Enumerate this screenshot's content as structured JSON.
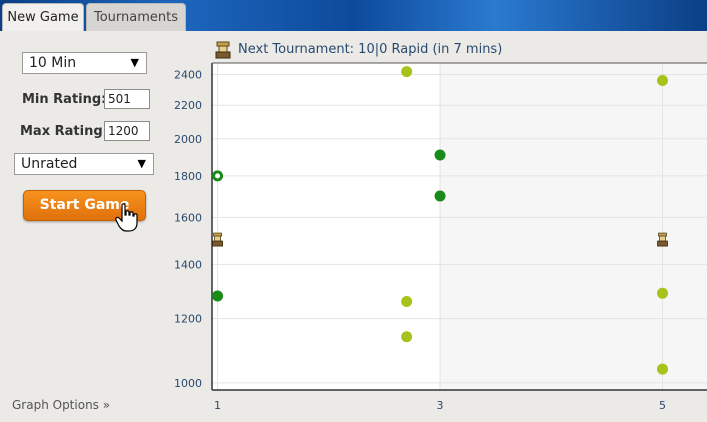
{
  "tabs": {
    "new_game": "New Game",
    "tournaments": "Tournaments"
  },
  "controls": {
    "time_select": "10 Min",
    "min_rating_label": "Min Rating:",
    "min_rating_value": "501",
    "max_rating_label": "Max Rating:",
    "max_rating_value": "1200",
    "rated_select": "Unrated",
    "start_button": "Start Game"
  },
  "graph_options": "Graph Options »",
  "next_tournament": "Next Tournament: 10|0 Rapid (in 7 mins)",
  "colors": {
    "accent_orange": "#f7931e",
    "dark_green": "#1a8a1a",
    "olive_green": "#a8c21c",
    "tab_bar_blue": "#0b3f86"
  },
  "icons": {
    "tournament": "tournament-trophy-icon",
    "cursor": "hand-cursor-icon"
  },
  "chart_data": {
    "type": "scatter",
    "ylim": [
      980,
      2480
    ],
    "y_scale": "log",
    "xlim": [
      0.95,
      5.4
    ],
    "x_ticks": [
      "1",
      "3",
      "5"
    ],
    "y_ticks": [
      "2400",
      "2200",
      "2000",
      "1800",
      "1600",
      "1400",
      "1200",
      "1000"
    ],
    "grid": true,
    "series": [
      {
        "color": "#1a8a1a",
        "points": [
          {
            "x": 1,
            "y": 1280
          },
          {
            "x": 3,
            "y": 1910
          },
          {
            "x": 3,
            "y": 1700
          }
        ]
      },
      {
        "color": "#1a8a1a",
        "hollow": true,
        "points": [
          {
            "x": 1,
            "y": 1800
          }
        ]
      },
      {
        "color": "#a8c21c",
        "points": [
          {
            "x": 2.7,
            "y": 2420
          },
          {
            "x": 2.7,
            "y": 1260
          },
          {
            "x": 2.7,
            "y": 1140
          },
          {
            "x": 5,
            "y": 2360
          },
          {
            "x": 5,
            "y": 1290
          },
          {
            "x": 5,
            "y": 1040
          }
        ]
      }
    ],
    "tournament_markers": [
      {
        "x": 1,
        "y": 1500
      },
      {
        "x": 5,
        "y": 1500
      }
    ]
  }
}
